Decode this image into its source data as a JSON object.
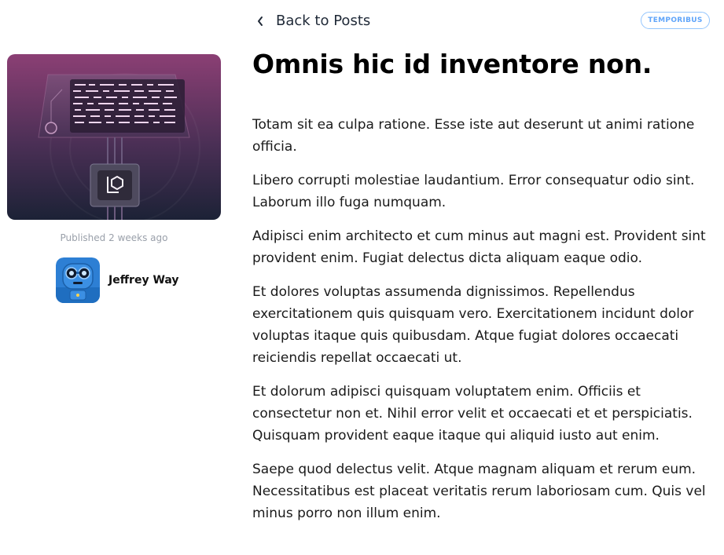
{
  "nav": {
    "back_label": "Back to Posts"
  },
  "post": {
    "category": "TEMPORIBUS",
    "title": "Omnis hic id inventore non.",
    "published_prefix": "Published",
    "published_when": "2 weeks ago",
    "author": "Jeffrey Way",
    "paragraphs": [
      "Totam sit ea culpa ratione. Esse iste aut deserunt ut animi ratione officia.",
      "Libero corrupti molestiae laudantium. Error consequatur odio sint. Laborum illo fuga numquam.",
      "Adipisci enim architecto et cum minus aut magni est. Provident sint provident enim. Fugiat delectus dicta aliquam eaque odio.",
      "Et dolores voluptas assumenda dignissimos. Repellendus exercitationem quis quisquam vero. Exercitationem incidunt dolor voluptas itaque quis quibusdam. Atque fugiat dolores occaecati reiciendis repellat occaecati ut.",
      "Et dolorum adipisci quisquam voluptatem enim. Officiis et consectetur non et. Nihil error velit et occaecati et et perspiciatis. Quisquam provident eaque itaque qui aliquid iusto aut enim.",
      "Saepe quod delectus velit. Atque magnam aliquam et rerum eum. Necessitatibus est placeat veritatis rerum laboriosam cum. Quis vel minus porro non illum enim."
    ]
  },
  "icons": {
    "back": "chevron-left-icon",
    "thumbnail": "laravel-illustration",
    "avatar": "robot-avatar"
  },
  "colors": {
    "badge_border": "#93c5fd",
    "badge_text": "#60a5fa",
    "thumb_top": "#8b3f74",
    "thumb_bottom": "#1c2236"
  }
}
